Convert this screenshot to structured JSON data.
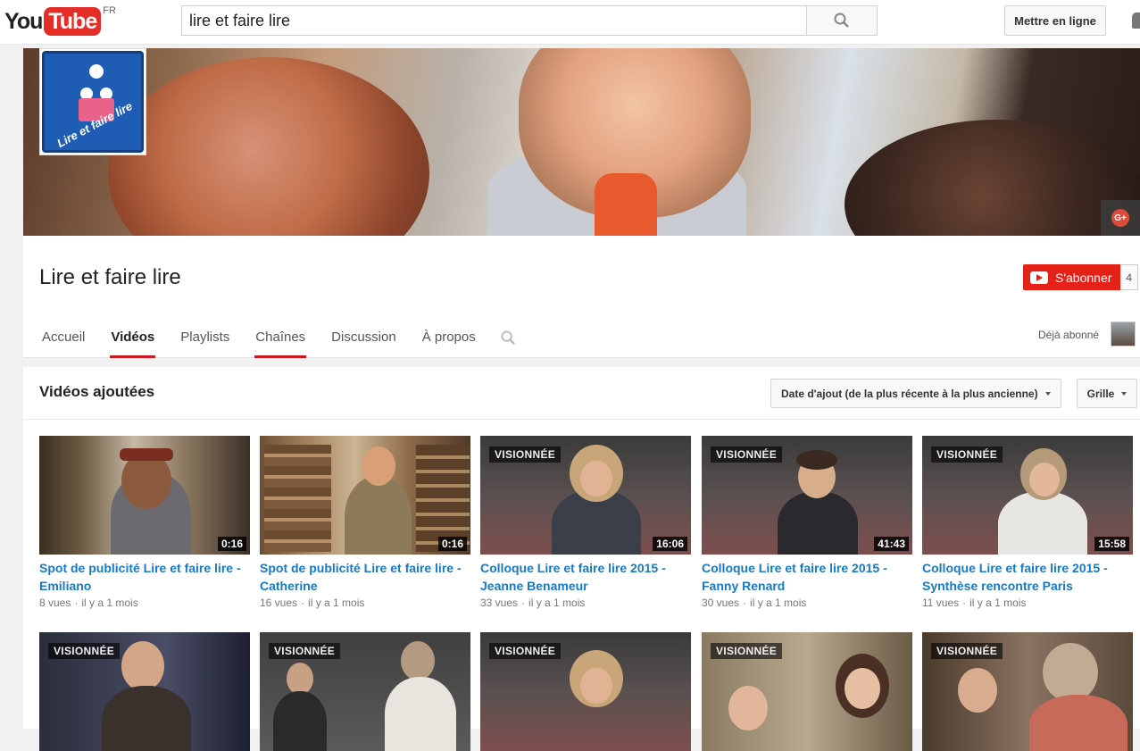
{
  "header": {
    "logo_you": "You",
    "logo_tube": "Tube",
    "logo_region": "FR",
    "search_value": "lire et faire lire",
    "upload_label": "Mettre en ligne"
  },
  "channel": {
    "avatar_text": "Lire et faire lire",
    "title": "Lire et faire lire",
    "subscribe_label": "S'abonner",
    "subscriber_count": "4",
    "already_subscribed": "Déjà abonné",
    "tabs": [
      {
        "label": "Accueil"
      },
      {
        "label": "Vidéos"
      },
      {
        "label": "Playlists"
      },
      {
        "label": "Chaînes"
      },
      {
        "label": "Discussion"
      },
      {
        "label": "À propos"
      }
    ]
  },
  "content": {
    "heading": "Vidéos ajoutées",
    "sort_label": "Date d'ajout (de la plus récente à la plus ancienne)",
    "view_label": "Grille",
    "watched_label": "VISIONNÉE",
    "videos": [
      {
        "title": "Spot de publicité Lire et faire lire - Emiliano",
        "duration": "0:16",
        "views": "8 vues",
        "age": "il y a 1 mois"
      },
      {
        "title": "Spot de publicité Lire et faire lire - Catherine",
        "duration": "0:16",
        "views": "16 vues",
        "age": "il y a 1 mois"
      },
      {
        "title": "Colloque Lire et faire lire 2015 - Jeanne Benameur",
        "duration": "16:06",
        "views": "33 vues",
        "age": "il y a 1 mois"
      },
      {
        "title": "Colloque Lire et faire lire 2015 - Fanny Renard",
        "duration": "41:43",
        "views": "30 vues",
        "age": "il y a 1 mois"
      },
      {
        "title": "Colloque Lire et faire lire 2015 - Synthèse rencontre Paris",
        "duration": "15:58",
        "views": "11 vues",
        "age": "il y a 1 mois"
      }
    ]
  }
}
